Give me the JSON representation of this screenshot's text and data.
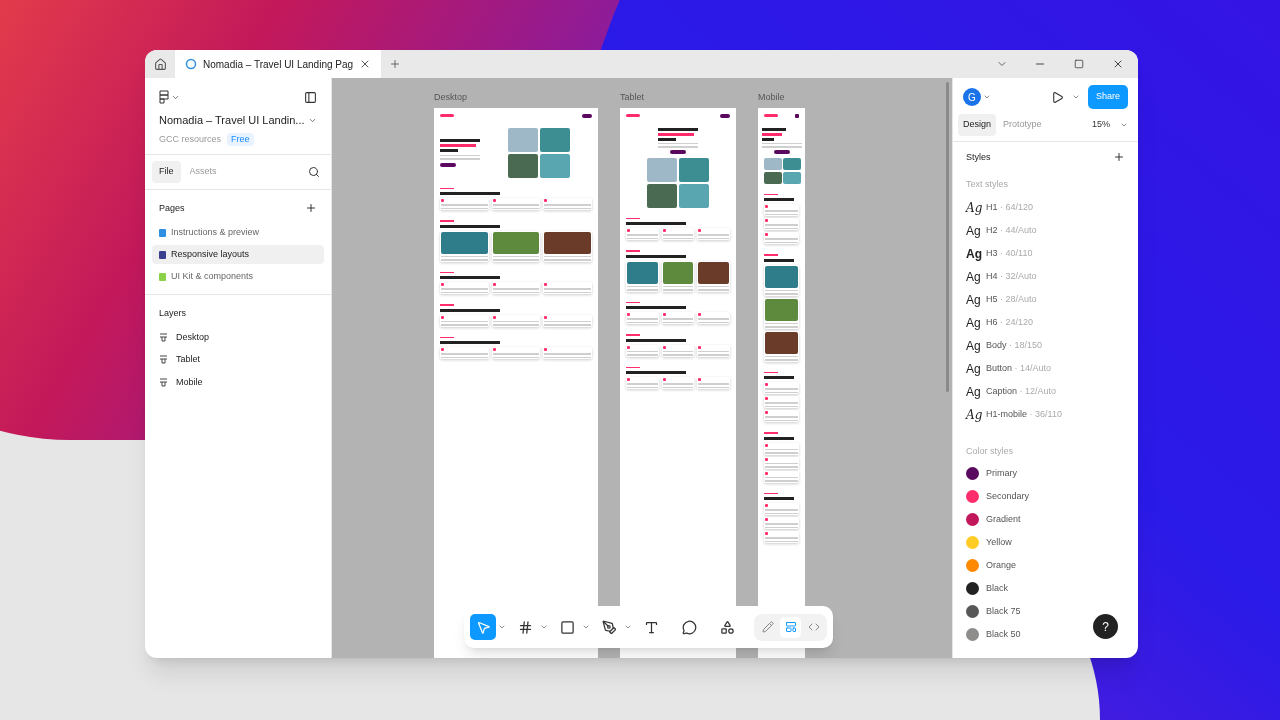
{
  "tab_bar": {
    "tab_title": "Nomadia – Travel UI Landing Pag"
  },
  "left_panel": {
    "file_title": "Nomadia – Travel UI Landin...",
    "team": "GCC resources",
    "plan_badge": "Free",
    "tabs": [
      {
        "label": "File",
        "selected": true
      },
      {
        "label": "Assets",
        "selected": false
      }
    ],
    "pages_title": "Pages",
    "pages": [
      {
        "label": "Instructions & preview",
        "color": "#2f8fe0",
        "selected": false
      },
      {
        "label": "Responsive layouts",
        "color": "#3b3f8f",
        "selected": true
      },
      {
        "label": "UI Kit & components",
        "color": "#8bd14a",
        "selected": false
      }
    ],
    "layers_title": "Layers",
    "layers": [
      {
        "label": "Desktop"
      },
      {
        "label": "Tablet"
      },
      {
        "label": "Mobile"
      }
    ]
  },
  "canvas": {
    "frames": [
      {
        "label": "Desktop",
        "kind": "desktop"
      },
      {
        "label": "Tablet",
        "kind": "tablet"
      },
      {
        "label": "Mobile",
        "kind": "mobile"
      }
    ],
    "tools": [
      {
        "kind": "move",
        "selected": true,
        "menu": true
      },
      {
        "kind": "frame",
        "selected": false,
        "menu": true
      },
      {
        "kind": "shape",
        "selected": false,
        "menu": true
      },
      {
        "kind": "pen",
        "selected": false,
        "menu": true
      },
      {
        "kind": "text",
        "selected": false,
        "menu": false
      },
      {
        "kind": "comment",
        "selected": false,
        "menu": false
      },
      {
        "kind": "actions",
        "selected": false,
        "menu": false
      }
    ],
    "modes": [
      {
        "kind": "draw",
        "selected": false
      },
      {
        "kind": "design",
        "selected": true
      },
      {
        "kind": "dev",
        "selected": false
      }
    ]
  },
  "right_panel": {
    "avatar": "G",
    "share": "Share",
    "tabs": [
      {
        "label": "Design",
        "selected": true
      },
      {
        "label": "Prototype",
        "selected": false
      }
    ],
    "zoom": "15%",
    "styles_title": "Styles",
    "text_styles_title": "Text styles",
    "text_styles": [
      {
        "kind": "script",
        "sample": "Ag",
        "name": "H1",
        "spec": "· 64/120"
      },
      {
        "kind": "regular",
        "sample": "Ag",
        "name": "H2",
        "spec": "· 44/Auto"
      },
      {
        "kind": "bold",
        "sample": "Ag",
        "name": "H3",
        "spec": "· 40/110"
      },
      {
        "kind": "regular",
        "sample": "Ag",
        "name": "H4",
        "spec": "· 32/Auto"
      },
      {
        "kind": "regular",
        "sample": "Ag",
        "name": "H5",
        "spec": "· 28/Auto"
      },
      {
        "kind": "regular",
        "sample": "Ag",
        "name": "H6",
        "spec": "· 24/120"
      },
      {
        "kind": "regular",
        "sample": "Ag",
        "name": "Body",
        "spec": "· 18/150"
      },
      {
        "kind": "regular",
        "sample": "Ag",
        "name": "Button",
        "spec": "· 14/Auto"
      },
      {
        "kind": "regular",
        "sample": "Ag",
        "name": "Caption",
        "spec": "· 12/Auto"
      },
      {
        "kind": "script",
        "sample": "Ag",
        "name": "H1-mobile",
        "spec": "· 36/110"
      }
    ],
    "color_styles_title": "Color styles",
    "color_styles": [
      {
        "name": "Primary",
        "color": "#5a0a5e"
      },
      {
        "name": "Secondary",
        "color": "#ff2d6b"
      },
      {
        "name": "Gradient",
        "color": "#c2185b"
      },
      {
        "name": "Yellow",
        "color": "#ffcc26"
      },
      {
        "name": "Orange",
        "color": "#ff8a00"
      },
      {
        "name": "Black",
        "color": "#222222"
      },
      {
        "name": "Black 75",
        "color": "#575757"
      },
      {
        "name": "Black 50",
        "color": "#8f8c8c"
      }
    ],
    "help": "?"
  }
}
